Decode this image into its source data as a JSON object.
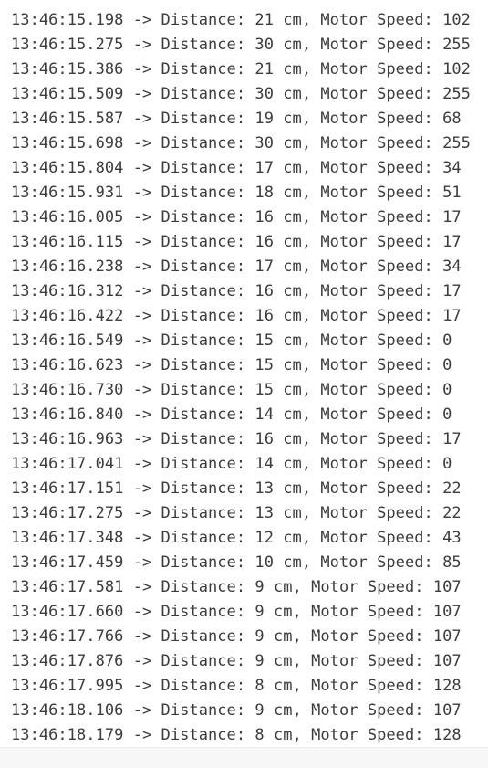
{
  "log": {
    "lines": [
      "13:46:15.198 -> Distance: 21 cm, Motor Speed: 102",
      "13:46:15.275 -> Distance: 30 cm, Motor Speed: 255",
      "13:46:15.386 -> Distance: 21 cm, Motor Speed: 102",
      "13:46:15.509 -> Distance: 30 cm, Motor Speed: 255",
      "13:46:15.587 -> Distance: 19 cm, Motor Speed: 68",
      "13:46:15.698 -> Distance: 30 cm, Motor Speed: 255",
      "13:46:15.804 -> Distance: 17 cm, Motor Speed: 34",
      "13:46:15.931 -> Distance: 18 cm, Motor Speed: 51",
      "13:46:16.005 -> Distance: 16 cm, Motor Speed: 17",
      "13:46:16.115 -> Distance: 16 cm, Motor Speed: 17",
      "13:46:16.238 -> Distance: 17 cm, Motor Speed: 34",
      "13:46:16.312 -> Distance: 16 cm, Motor Speed: 17",
      "13:46:16.422 -> Distance: 16 cm, Motor Speed: 17",
      "13:46:16.549 -> Distance: 15 cm, Motor Speed: 0",
      "13:46:16.623 -> Distance: 15 cm, Motor Speed: 0",
      "13:46:16.730 -> Distance: 15 cm, Motor Speed: 0",
      "13:46:16.840 -> Distance: 14 cm, Motor Speed: 0",
      "13:46:16.963 -> Distance: 16 cm, Motor Speed: 17",
      "13:46:17.041 -> Distance: 14 cm, Motor Speed: 0",
      "13:46:17.151 -> Distance: 13 cm, Motor Speed: 22",
      "13:46:17.275 -> Distance: 13 cm, Motor Speed: 22",
      "13:46:17.348 -> Distance: 12 cm, Motor Speed: 43",
      "13:46:17.459 -> Distance: 10 cm, Motor Speed: 85",
      "13:46:17.581 -> Distance: 9 cm, Motor Speed: 107",
      "13:46:17.660 -> Distance: 9 cm, Motor Speed: 107",
      "13:46:17.766 -> Distance: 9 cm, Motor Speed: 107",
      "13:46:17.876 -> Distance: 9 cm, Motor Speed: 107",
      "13:46:17.995 -> Distance: 8 cm, Motor Speed: 128",
      "13:46:18.106 -> Distance: 9 cm, Motor Speed: 107",
      "13:46:18.179 -> Distance: 8 cm, Motor Speed: 128"
    ]
  },
  "colors": {
    "text": "#3c3c3c",
    "background": "#ffffff"
  }
}
